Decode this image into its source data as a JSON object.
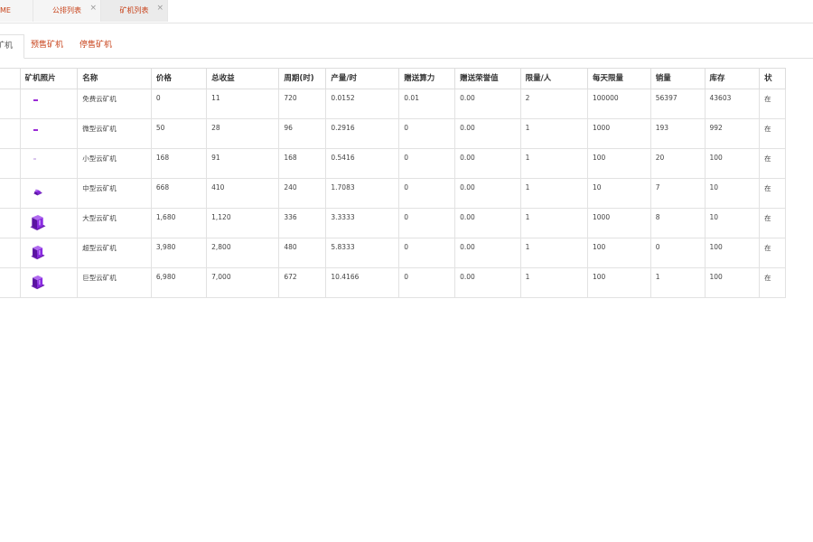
{
  "top_tabs": [
    {
      "label": "ME",
      "closable": false
    },
    {
      "label": "公排列表",
      "closable": true
    },
    {
      "label": "矿机列表",
      "closable": true
    }
  ],
  "close_glyph": "×",
  "sub_tabs": [
    "矿机",
    "预售矿机",
    "停售矿机"
  ],
  "table": {
    "headers": [
      "矿机照片",
      "名称",
      "价格",
      "总收益",
      "周期(时)",
      "产量/时",
      "赠送算力",
      "赠送荣誉值",
      "限量/人",
      "每天限量",
      "销量",
      "库存",
      "状"
    ],
    "rows": [
      {
        "image": "tiny",
        "name": "免费云矿机",
        "price": "0",
        "total": "11",
        "cycle": "720",
        "output": "0.0152",
        "power": "0.01",
        "honor": "0.00",
        "limit": "2",
        "daily": "100000",
        "sales": "56397",
        "stock": "43603",
        "status": "在"
      },
      {
        "image": "tiny",
        "name": "微型云矿机",
        "price": "50",
        "total": "28",
        "cycle": "96",
        "output": "0.2916",
        "power": "0",
        "honor": "0.00",
        "limit": "1",
        "daily": "1000",
        "sales": "193",
        "stock": "992",
        "status": "在"
      },
      {
        "image": "dot",
        "name": "小型云矿机",
        "price": "168",
        "total": "91",
        "cycle": "168",
        "output": "0.5416",
        "power": "0",
        "honor": "0.00",
        "limit": "1",
        "daily": "100",
        "sales": "20",
        "stock": "100",
        "status": "在"
      },
      {
        "image": "small",
        "name": "中型云矿机",
        "price": "668",
        "total": "410",
        "cycle": "240",
        "output": "1.7083",
        "power": "0",
        "honor": "0.00",
        "limit": "1",
        "daily": "10",
        "sales": "7",
        "stock": "10",
        "status": "在"
      },
      {
        "image": "big",
        "name": "大型云矿机",
        "price": "1,680",
        "total": "1,120",
        "cycle": "336",
        "output": "3.3333",
        "power": "0",
        "honor": "0.00",
        "limit": "1",
        "daily": "1000",
        "sales": "8",
        "stock": "10",
        "status": "在"
      },
      {
        "image": "mid",
        "name": "超型云矿机",
        "price": "3,980",
        "total": "2,800",
        "cycle": "480",
        "output": "5.8333",
        "power": "0",
        "honor": "0.00",
        "limit": "1",
        "daily": "100",
        "sales": "0",
        "stock": "100",
        "status": "在"
      },
      {
        "image": "mid",
        "name": "巨型云矿机",
        "price": "6,980",
        "total": "7,000",
        "cycle": "672",
        "output": "10.4166",
        "power": "0",
        "honor": "0.00",
        "limit": "1",
        "daily": "100",
        "sales": "1",
        "stock": "100",
        "status": "在"
      }
    ]
  },
  "colors": {
    "accent": "#c8431b",
    "image_purple": "#8a2be2"
  }
}
